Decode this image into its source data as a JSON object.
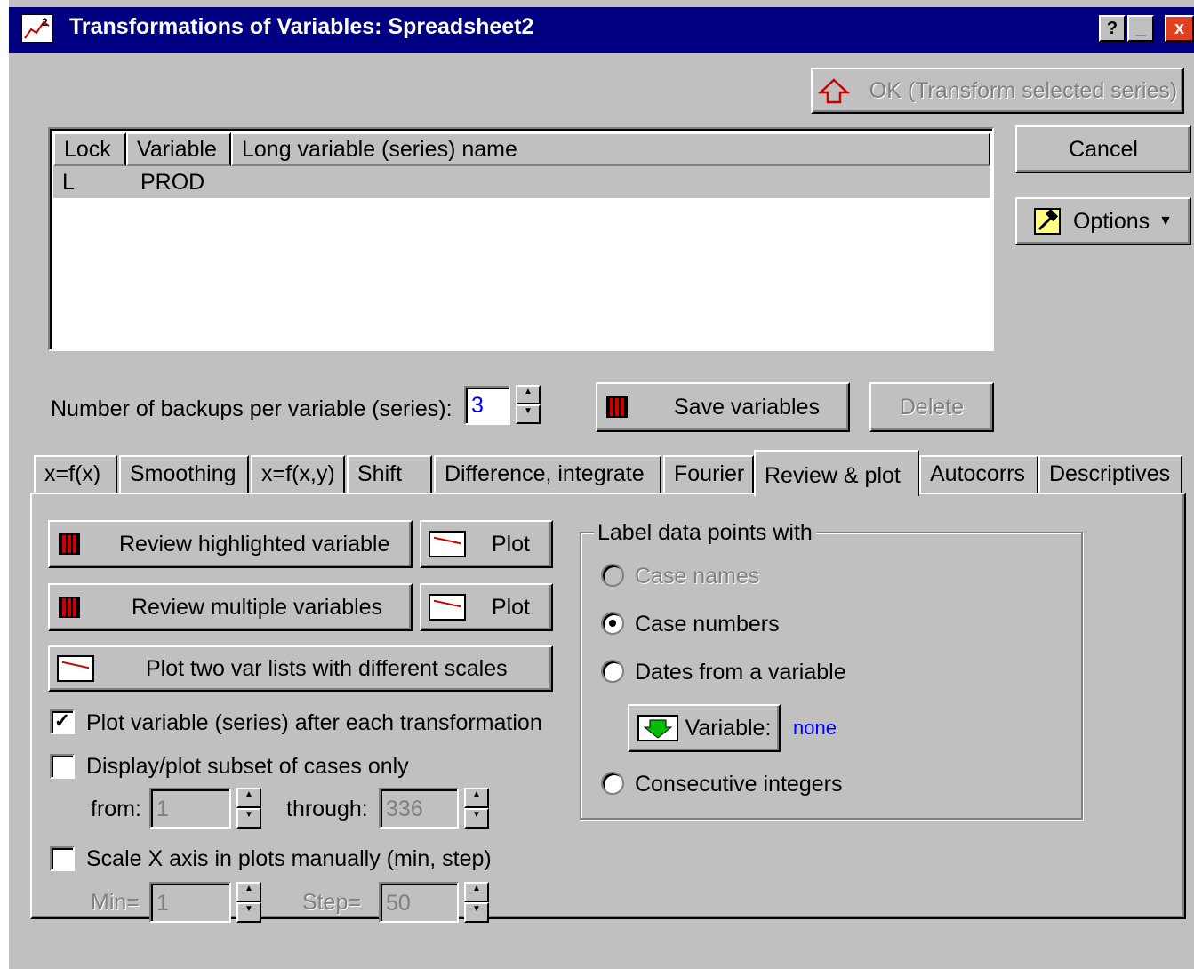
{
  "window": {
    "title": "Transformations of Variables: Spreadsheet2",
    "help_btn": "?",
    "min_btn": "_",
    "close_btn": "x"
  },
  "buttons": {
    "ok": "OK (Transform selected series)",
    "cancel": "Cancel",
    "options": "Options",
    "save_variables": "Save variables",
    "delete": "Delete"
  },
  "list": {
    "headers": [
      "Lock",
      "Variable",
      "Long variable (series) name"
    ],
    "rows": [
      {
        "lock": "L",
        "variable": "PROD",
        "long_name": ""
      }
    ]
  },
  "backups": {
    "label": "Number of backups per variable (series):",
    "value": "3"
  },
  "tabs": [
    "x=f(x)",
    "Smoothing",
    "x=f(x,y)",
    "Shift",
    "Difference, integrate",
    "Fourier",
    "Review & plot",
    "Autocorrs",
    "Descriptives"
  ],
  "active_tab": "Review & plot",
  "review": {
    "review_highlighted": "Review highlighted variable",
    "review_multiple": "Review multiple variables",
    "plot1": "Plot",
    "plot2": "Plot",
    "plot_two_lists": "Plot two var lists with different scales",
    "plot_after_each": "Plot variable (series) after each transformation",
    "plot_after_each_checked": true,
    "subset_only": "Display/plot subset of cases only",
    "subset_checked": false,
    "from_label": "from:",
    "from_value": "1",
    "through_label": "through:",
    "through_value": "336",
    "scale_x": "Scale X axis in plots manually (min, step)",
    "scale_x_checked": false,
    "min_label": "Min=",
    "min_value": "1",
    "step_label": "Step=",
    "step_value": "50"
  },
  "label_group": {
    "title": "Label data points with",
    "case_names": "Case names",
    "case_numbers": "Case numbers",
    "dates_from_variable": "Dates from a variable",
    "variable_button": "Variable:",
    "variable_value": "none",
    "consecutive_integers": "Consecutive integers",
    "selected": "Case numbers"
  },
  "colors": {
    "face": "#c0c0c0",
    "title_bar": "#000080",
    "link_value": "#0000ff"
  }
}
